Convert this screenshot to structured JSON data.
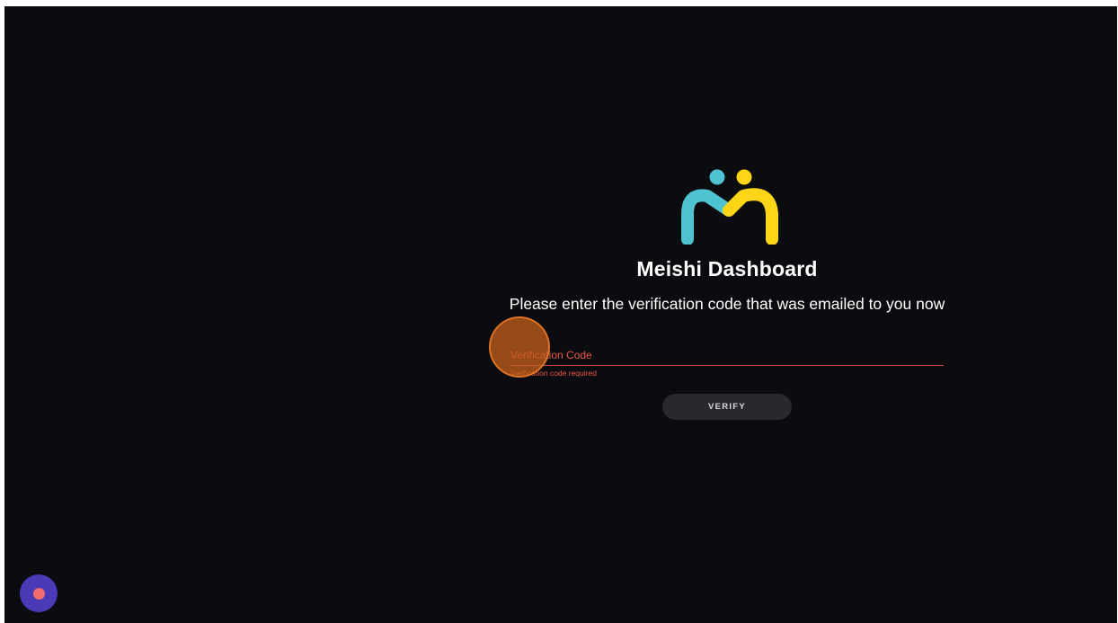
{
  "app": {
    "title": "Meishi Dashboard",
    "logo_icon": "meishi-logo-icon"
  },
  "verification": {
    "prompt": "Please enter the verification code that was emailed to you now",
    "code_field": {
      "placeholder": "Verification Code",
      "value": "",
      "error": "Verification code required"
    },
    "verify_label": "VERIFY"
  },
  "fab": {
    "icon": "record-dot-icon"
  },
  "colors": {
    "background": "#0b0c0f",
    "logo_teal": "#4fc3d1",
    "logo_yellow": "#ffd617",
    "error": "#e9574a",
    "button_bg": "#27292d",
    "fab": "#4a3ab7",
    "fab_dot": "#f26b6e"
  }
}
